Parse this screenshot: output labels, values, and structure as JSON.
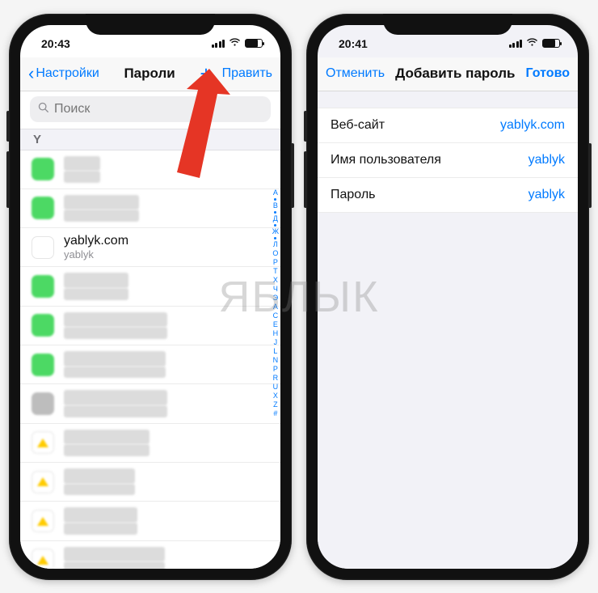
{
  "status": {
    "time_left": "20:43",
    "time_right": "20:41"
  },
  "left": {
    "back_label": "Настройки",
    "title": "Пароли",
    "add_label": "+",
    "edit_label": "Править",
    "search_placeholder": "Поиск",
    "section": "Y",
    "index_letters": [
      "А",
      "В",
      "Д",
      "Ж",
      "Л",
      "О",
      "Р",
      "Т",
      "Х",
      "Ч",
      "Э",
      "A",
      "C",
      "E",
      "H",
      "J",
      "L",
      "N",
      "P",
      "R",
      "U",
      "X",
      "Z",
      "#"
    ],
    "rows": [
      {
        "site": "yablyk",
        "user": "u-help",
        "fav": "green",
        "blur": true
      },
      {
        "site": "yablyk.com",
        "user": "activegmail.com",
        "fav": "green",
        "blur": true
      },
      {
        "site": "yablyk.com",
        "user": "yablyk",
        "fav": "white",
        "icon": "Я",
        "blur": false
      },
      {
        "site": "yablyk.com",
        "user": "yablyk-info",
        "fav": "green",
        "blur": true
      },
      {
        "site": "yablyk.com",
        "user": "password@gmail.com",
        "fav": "green",
        "blur": true
      },
      {
        "site": "yablyk.com",
        "user": "someone@gmail.com",
        "fav": "green",
        "blur": true
      },
      {
        "site": "yandex-team.ru",
        "user": "username@yandex.ru",
        "fav": "grey",
        "blur": true
      },
      {
        "site": "yandex.by",
        "user": "admin@yandex.ru",
        "fav": "yellow",
        "blur": true
      },
      {
        "site": "yandex.by",
        "user": "infouser@ya.ru",
        "fav": "yellow",
        "blur": true
      },
      {
        "site": "yandex.by",
        "user": "one_two@ya.ru",
        "fav": "yellow",
        "blur": true
      },
      {
        "site": "yandex.by",
        "user": "anton.me@yandex.ru",
        "fav": "yellow",
        "blur": true
      }
    ]
  },
  "right": {
    "cancel_label": "Отменить",
    "title": "Добавить пароль",
    "done_label": "Готово",
    "fields": [
      {
        "label": "Веб-сайт",
        "value": "yablyk.com"
      },
      {
        "label": "Имя пользователя",
        "value": "yablyk"
      },
      {
        "label": "Пароль",
        "value": "yablyk"
      }
    ]
  },
  "watermark": "ЯБЛЫК"
}
